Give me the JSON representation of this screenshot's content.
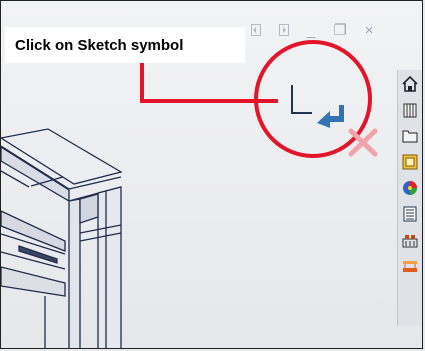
{
  "annotation": {
    "text": "Click on Sketch symbol"
  },
  "window_controls": [
    {
      "name": "collapse-left",
      "glyph": ""
    },
    {
      "name": "collapse-right",
      "glyph": ""
    },
    {
      "name": "minimize",
      "glyph": "_"
    },
    {
      "name": "restore",
      "glyph": "❐"
    },
    {
      "name": "close",
      "glyph": "×"
    }
  ],
  "sketch_exit_icon": "sketch-exit-icon",
  "cancel_icon": "cancel-x-icon",
  "taskpane": [
    "home-icon",
    "design-library-icon",
    "file-explorer-icon",
    "view-palette-icon",
    "appearances-icon",
    "custom-properties-icon",
    "forum-icon",
    "toolbox-icon"
  ],
  "colors": {
    "annotation_red": "#e4152b",
    "frame_blue": "#1f2c4e"
  }
}
